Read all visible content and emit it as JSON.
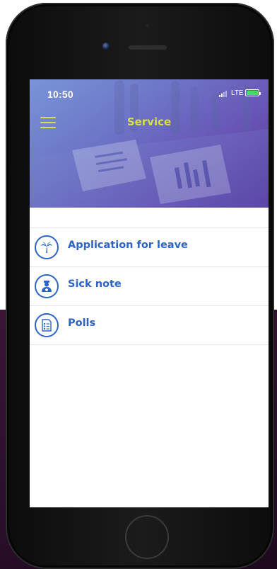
{
  "status_bar": {
    "time": "10:50",
    "network": "LTE",
    "battery_color": "#4ad964"
  },
  "header": {
    "title": "Service",
    "menu_icon": "hamburger-menu-icon",
    "title_color": "#d6e043",
    "gradient": [
      "#6f8cd2",
      "#6b52b8",
      "#5a3aa3"
    ]
  },
  "service_list": {
    "accent_color": "#2b63c6",
    "items": [
      {
        "label": "Application for leave",
        "icon": "palm-tree-icon"
      },
      {
        "label": "Sick note",
        "icon": "doctor-icon"
      },
      {
        "label": "Polls",
        "icon": "poll-document-icon"
      }
    ]
  }
}
